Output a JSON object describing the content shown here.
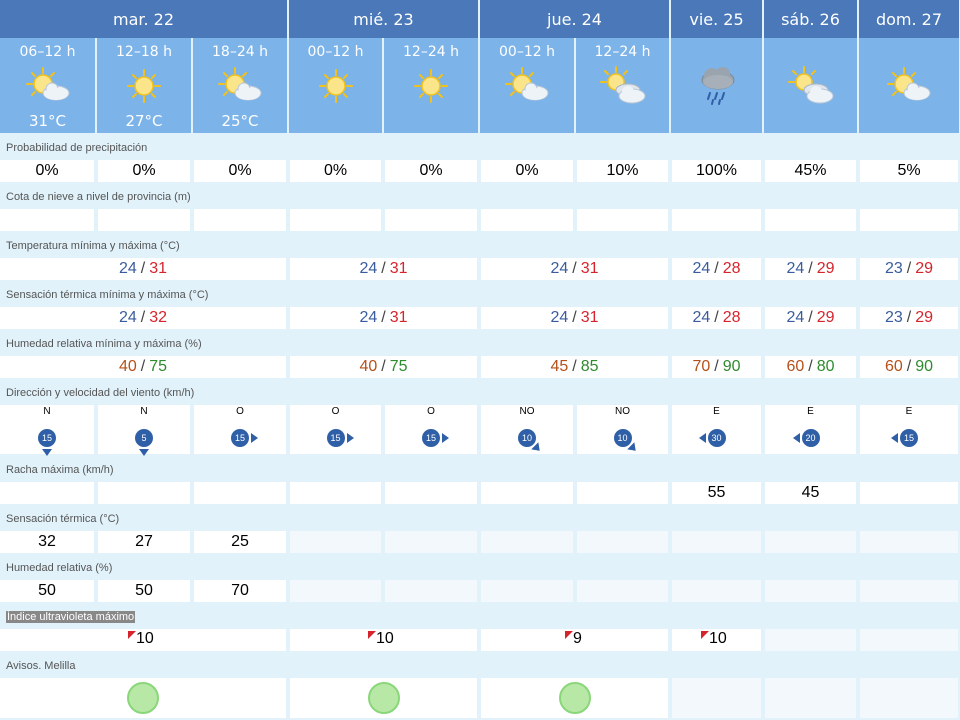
{
  "days": [
    {
      "label": "mar. 22"
    },
    {
      "label": "mié. 23"
    },
    {
      "label": "jue. 24"
    },
    {
      "label": "vie. 25"
    },
    {
      "label": "sáb. 26"
    },
    {
      "label": "dom. 27"
    }
  ],
  "periods": [
    {
      "label": "06–12 h",
      "icon": "sun-cloud-icon",
      "temp": "31°C"
    },
    {
      "label": "12–18 h",
      "icon": "sun-icon",
      "temp": "27°C"
    },
    {
      "label": "18–24 h",
      "icon": "sun-cloud-icon",
      "temp": "25°C"
    },
    {
      "label": "00–12 h",
      "icon": "sun-icon",
      "temp": ""
    },
    {
      "label": "12–24 h",
      "icon": "sun-icon",
      "temp": ""
    },
    {
      "label": "00–12 h",
      "icon": "sun-cloud-icon",
      "temp": ""
    },
    {
      "label": "12–24 h",
      "icon": "sun-clouds-icon",
      "temp": ""
    },
    {
      "label": "",
      "icon": "rain-cloud-icon",
      "temp": ""
    },
    {
      "label": "",
      "icon": "sun-clouds-icon",
      "temp": ""
    },
    {
      "label": "",
      "icon": "sun-cloud-icon",
      "temp": ""
    }
  ],
  "sections": {
    "precip": "Probabilidad de precipitación",
    "snow": "Cota de nieve a nivel de provincia (m)",
    "temp": "Temperatura mínima y máxima (°C)",
    "feel": "Sensación térmica mínima y máxima (°C)",
    "hum": "Humedad relativa mínima y máxima (%)",
    "wind": "Dirección y velocidad del viento (km/h)",
    "gust": "Racha máxima (km/h)",
    "feelp": "Sensación térmica (°C)",
    "hump": "Humedad relativa (%)",
    "uv": "Índice ultravioleta máximo",
    "warn": "Avisos. Melilla"
  },
  "precip": [
    "0%",
    "0%",
    "0%",
    "0%",
    "0%",
    "0%",
    "10%",
    "100%",
    "45%",
    "5%"
  ],
  "temp": [
    {
      "min": "24",
      "max": "31"
    },
    {
      "min": "24",
      "max": "31"
    },
    {
      "min": "24",
      "max": "31"
    },
    {
      "min": "24",
      "max": "28"
    },
    {
      "min": "24",
      "max": "29"
    },
    {
      "min": "23",
      "max": "29"
    }
  ],
  "feel": [
    {
      "min": "24",
      "max": "32"
    },
    {
      "min": "24",
      "max": "31"
    },
    {
      "min": "24",
      "max": "31"
    },
    {
      "min": "24",
      "max": "28"
    },
    {
      "min": "24",
      "max": "29"
    },
    {
      "min": "23",
      "max": "29"
    }
  ],
  "hum": [
    {
      "min": "40",
      "max": "75"
    },
    {
      "min": "40",
      "max": "75"
    },
    {
      "min": "45",
      "max": "85"
    },
    {
      "min": "70",
      "max": "90"
    },
    {
      "min": "60",
      "max": "80"
    },
    {
      "min": "60",
      "max": "90"
    }
  ],
  "wind": [
    {
      "dir": "N",
      "speed": "15"
    },
    {
      "dir": "N",
      "speed": "5"
    },
    {
      "dir": "O",
      "speed": "15"
    },
    {
      "dir": "O",
      "speed": "15"
    },
    {
      "dir": "O",
      "speed": "15"
    },
    {
      "dir": "NO",
      "speed": "10"
    },
    {
      "dir": "NO",
      "speed": "10"
    },
    {
      "dir": "E",
      "speed": "30"
    },
    {
      "dir": "E",
      "speed": "20"
    },
    {
      "dir": "E",
      "speed": "15"
    }
  ],
  "gust": [
    "",
    "",
    "",
    "",
    "",
    "",
    "",
    "55",
    "45",
    ""
  ],
  "feelp": [
    "32",
    "27",
    "25"
  ],
  "hump": [
    "50",
    "50",
    "70"
  ],
  "uv": [
    "10",
    "10",
    "9",
    "10"
  ],
  "colors": {
    "day_header": "#4a78b8",
    "period_header": "#7cb3e9",
    "row_bg": "#e1f2fa",
    "wind_circle": "#2f5fa6",
    "temp_min": "#3a5c9e",
    "temp_max": "#d6242c",
    "hum_min": "#b5501a",
    "hum_max": "#2e8b2e",
    "uv_flag": "#d6242c",
    "warning_green": "#b7e8a6"
  }
}
